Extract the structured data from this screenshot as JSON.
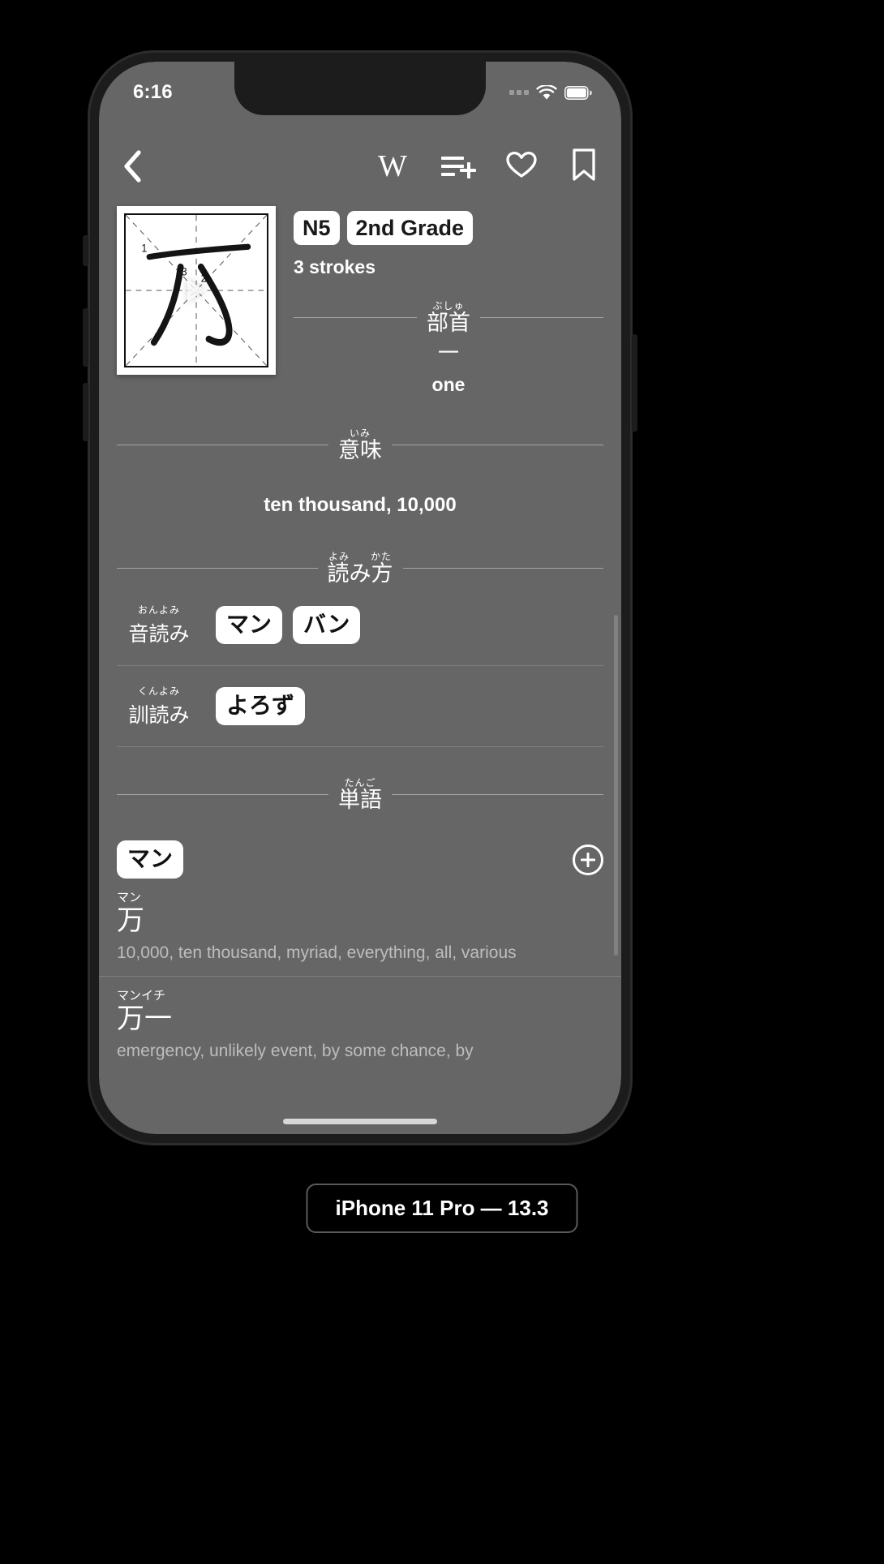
{
  "status_bar": {
    "time": "6:16",
    "cell_icon": "cellular-dots-icon",
    "wifi_icon": "wifi-icon",
    "battery_icon": "battery-full-icon"
  },
  "nav_bar": {
    "back_icon": "chevron-left-icon",
    "actions": [
      {
        "name": "wikipedia-button",
        "icon": "wikipedia-w-icon",
        "label": "W"
      },
      {
        "name": "add-to-list-button",
        "icon": "list-add-icon",
        "label": ""
      },
      {
        "name": "favorite-button",
        "icon": "heart-outline-icon",
        "label": ""
      },
      {
        "name": "bookmark-button",
        "icon": "bookmark-outline-icon",
        "label": ""
      }
    ]
  },
  "kanji": {
    "character": "万",
    "stroke_numbers": [
      "1",
      "2",
      "3"
    ],
    "play_icon": "play-triangle-icon",
    "badges": [
      "N5",
      "2nd Grade"
    ],
    "strokes_text": "3 strokes"
  },
  "radical": {
    "furigana": "ぶしゅ",
    "title": "部首",
    "character": "一",
    "meaning": "one"
  },
  "meaning_section": {
    "furigana": "いみ",
    "title": "意味",
    "text": "ten thousand, 10,000"
  },
  "readings_section": {
    "furigana_left": "よみ",
    "furigana_right": "かた",
    "title": "読み方",
    "rows": [
      {
        "furigana": "おんよみ",
        "label": "音読み",
        "values": [
          "マン",
          "バン"
        ]
      },
      {
        "furigana": "くんよみ",
        "label": "訓読み",
        "values": [
          "よろず"
        ]
      }
    ]
  },
  "vocabulary_section": {
    "furigana": "たんご",
    "title": "単語",
    "filter_pill": "マン",
    "add_icon": "plus-circle-icon",
    "entries": [
      {
        "reading": "マン",
        "word": "万",
        "definition": "10,000, ten thousand, myriad, everything, all, various"
      },
      {
        "reading": "マンイチ",
        "word": "万一",
        "definition": "emergency, unlikely event, by some chance, by"
      }
    ]
  },
  "device_caption": "iPhone 11 Pro — 13.3",
  "colors": {
    "screen_background": "#666666",
    "device_body": "#1c1c1c",
    "pill_background": "#ffffff",
    "definition_text": "#bdbdbd"
  }
}
